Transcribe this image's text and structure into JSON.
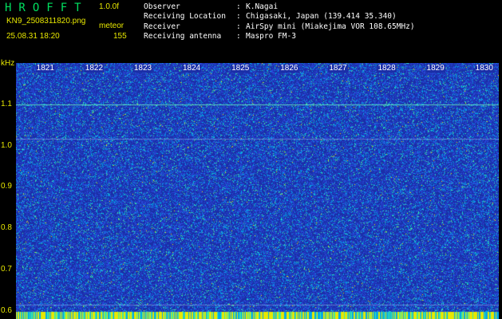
{
  "header": {
    "app_title": "HROFFT",
    "version": "1.0.0f",
    "filename": "KN9_2508311820.png",
    "mode": "meteor",
    "datetime": "25.08.31 18:20",
    "count": "155"
  },
  "info": [
    {
      "key": "Observer",
      "sep": ":",
      "value": "K.Nagai"
    },
    {
      "key": "Receiving Location",
      "sep": ":",
      "value": "Chigasaki, Japan (139.414 35.340)"
    },
    {
      "key": "Receiver",
      "sep": ":",
      "value": "AirSpy mini (Miakejima VOR 108.65MHz)"
    },
    {
      "key": "Receiving antenna",
      "sep": ":",
      "value": "Maspro FM-3"
    }
  ],
  "chart_data": {
    "type": "heatmap",
    "ylabel": "kHz",
    "y_ticks": [
      "1.1",
      "1.0",
      "0.9",
      "0.8",
      "0.7",
      "0.6"
    ],
    "y_tick_values": [
      1.1,
      1.0,
      0.9,
      0.8,
      0.7,
      0.6
    ],
    "ylim": [
      0.58,
      1.2
    ],
    "x_ticks": [
      "1821",
      "1822",
      "1823",
      "1824",
      "1825",
      "1826",
      "1827",
      "1828",
      "1829",
      "1830"
    ],
    "x_tick_values": [
      1821,
      1822,
      1823,
      1824,
      1825,
      1826,
      1827,
      1828,
      1829,
      1830
    ],
    "xlim": [
      1820.4,
      1830.3
    ],
    "horizontal_lines_khz": [
      1.1,
      1.016,
      0.615,
      0.597
    ],
    "colors": {
      "background": "#1b2fa8",
      "noise_low": "#2848d8",
      "noise_mid": "#00a8e8",
      "noise_high": "#40e8a0",
      "noise_peak": "#e8e800",
      "line": "#60e8c0"
    }
  }
}
